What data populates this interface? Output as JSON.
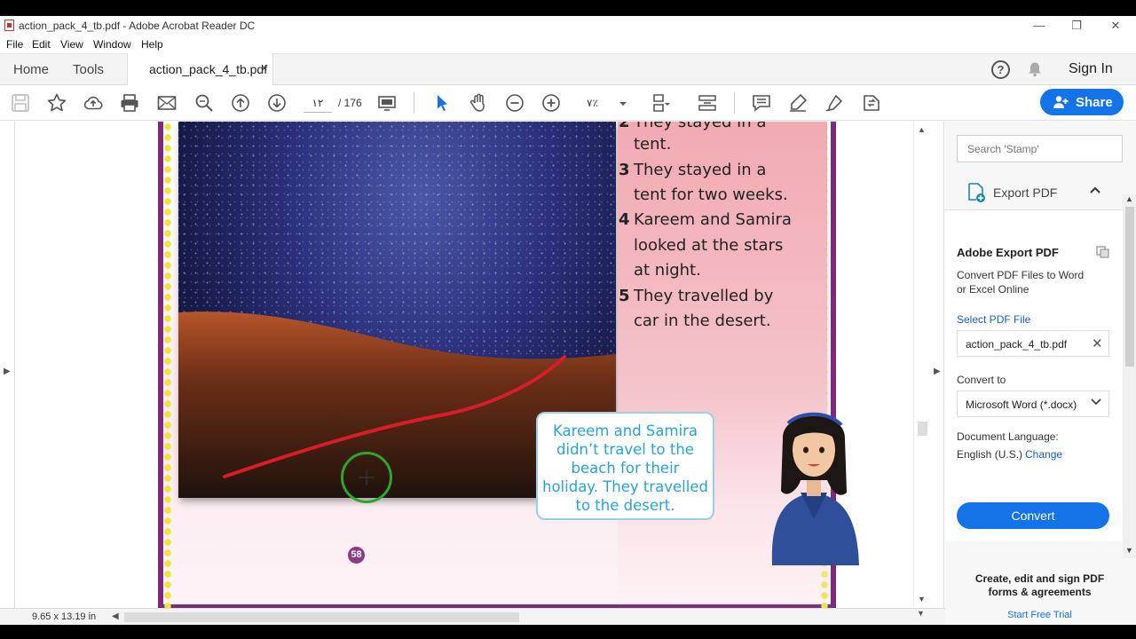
{
  "window": {
    "title": "action_pack_4_tb.pdf - Adobe Acrobat Reader DC",
    "minimize": "—",
    "restore": "❐",
    "close": "✕"
  },
  "menu": [
    "File",
    "Edit",
    "View",
    "Window",
    "Help"
  ],
  "tabs": {
    "home": "Home",
    "tools": "Tools",
    "document": "action_pack_4_tb.pdf",
    "close": "×",
    "help": "?",
    "signin": "Sign In"
  },
  "toolbar": {
    "page_current": "١٢",
    "page_count": "/  176",
    "zoom": "٧٪",
    "share": "Share"
  },
  "document": {
    "questions": [
      {
        "num": "",
        "lines": [
          "They stayed in a",
          "tent."
        ]
      },
      {
        "num": "3",
        "lines": [
          "They stayed in a",
          "tent for two weeks."
        ]
      },
      {
        "num": "4",
        "lines": [
          "Kareem and Samira",
          "looked at the stars",
          "at night."
        ]
      },
      {
        "num": "5",
        "lines": [
          "They travelled by",
          "car in the desert."
        ]
      }
    ],
    "bubble": [
      "Kareem and Samira",
      "didn’t travel to the",
      "beach for their",
      "holiday. They travelled",
      "to the desert."
    ],
    "page_number": "58"
  },
  "right_pane": {
    "search_placeholder": "Search 'Stamp'",
    "export_title": "Export PDF",
    "card_title": "Adobe Export PDF",
    "card_desc_1": "Convert PDF Files to Word",
    "card_desc_2": "or Excel Online",
    "select_file_label": "Select PDF File",
    "file_name": "action_pack_4_tb.pdf",
    "convert_to_label": "Convert to",
    "convert_to_value": "Microsoft Word (*.docx)",
    "doc_language_label": "Document Language:",
    "doc_language_value": "English (U.S.)",
    "change_link": "Change",
    "convert_button": "Convert",
    "promo_1": "Create, edit and sign PDF",
    "promo_2": "forms & agreements",
    "trial_link": "Start Free Trial"
  },
  "status": {
    "page_size": "9.65 x 13.19 in"
  },
  "colors": {
    "accent": "#1473e6",
    "page_border": "#7a2b7c",
    "bubble_text": "#2aa3d4",
    "pointer_ring": "#2aa62a"
  }
}
